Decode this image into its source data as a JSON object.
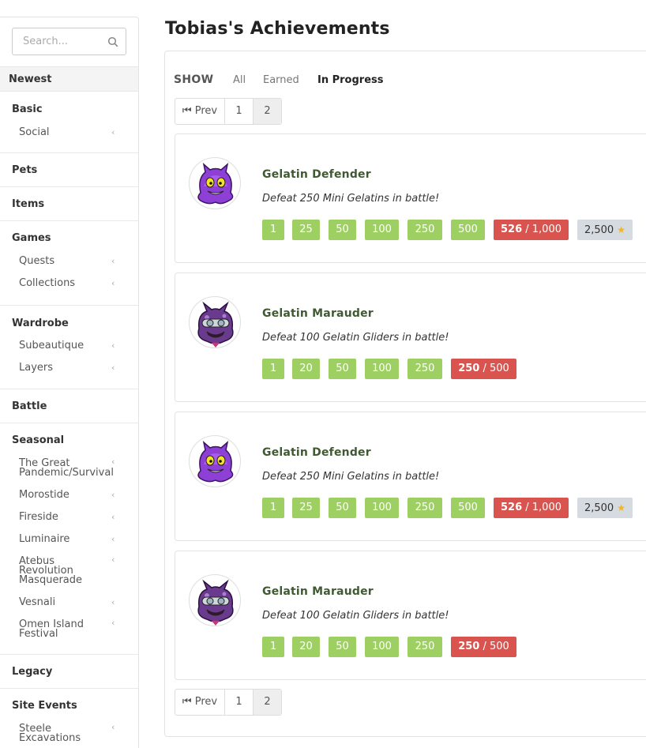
{
  "search": {
    "placeholder": "Search..."
  },
  "sidebar": {
    "newest": "Newest",
    "sections": {
      "basic": "Basic",
      "social": "Social",
      "pets": "Pets",
      "items": "Items",
      "games": "Games",
      "quests": "Quests",
      "collections": "Collections",
      "wardrobe": "Wardrobe",
      "subeautique": "Subeautique",
      "layers": "Layers",
      "battle": "Battle",
      "seasonal": "Seasonal",
      "pandemic": "The Great Pandemic/Survival",
      "morostide": "Morostide",
      "fireside": "Fireside",
      "luminaire": "Luminaire",
      "atebus": "Atebus Revolution Masquerade",
      "vesnali": "Vesnali",
      "omen": "Omen Island Festival",
      "legacy": "Legacy",
      "site_events": "Site Events",
      "steele": "Steele Excavations"
    },
    "chevron": "‹"
  },
  "main": {
    "title": "Tobias's Achievements",
    "show_label": "SHOW",
    "filters": {
      "all": "All",
      "earned": "Earned",
      "in_progress": "In Progress"
    },
    "pager": {
      "prev": "Prev",
      "p1": "1",
      "p2": "2"
    }
  },
  "achievements": [
    {
      "title": "Gelatin Defender",
      "desc": "Defeat 250 Mini Gelatins in battle!",
      "tiers": [
        "1",
        "25",
        "50",
        "100",
        "250",
        "500"
      ],
      "progress": "526",
      "total": " / 1,000",
      "reward": "2,500"
    },
    {
      "title": "Gelatin Marauder",
      "desc": "Defeat 100 Gelatin Gliders in battle!",
      "tiers": [
        "1",
        "20",
        "50",
        "100",
        "250"
      ],
      "progress": "250",
      "total": " / 500"
    },
    {
      "title": "Gelatin Defender",
      "desc": "Defeat 250 Mini Gelatins in battle!",
      "tiers": [
        "1",
        "25",
        "50",
        "100",
        "250",
        "500"
      ],
      "progress": "526",
      "total": " / 1,000",
      "reward": "2,500"
    },
    {
      "title": "Gelatin Marauder",
      "desc": "Defeat 100 Gelatin Gliders in battle!",
      "tiers": [
        "1",
        "20",
        "50",
        "100",
        "250"
      ],
      "progress": "250",
      "total": " / 500"
    }
  ],
  "colors": {
    "tier_green": "#9ecf62",
    "progress_red": "#d9534f",
    "reward_grey": "#d5dbe0",
    "title_green": "#3f5a32"
  }
}
